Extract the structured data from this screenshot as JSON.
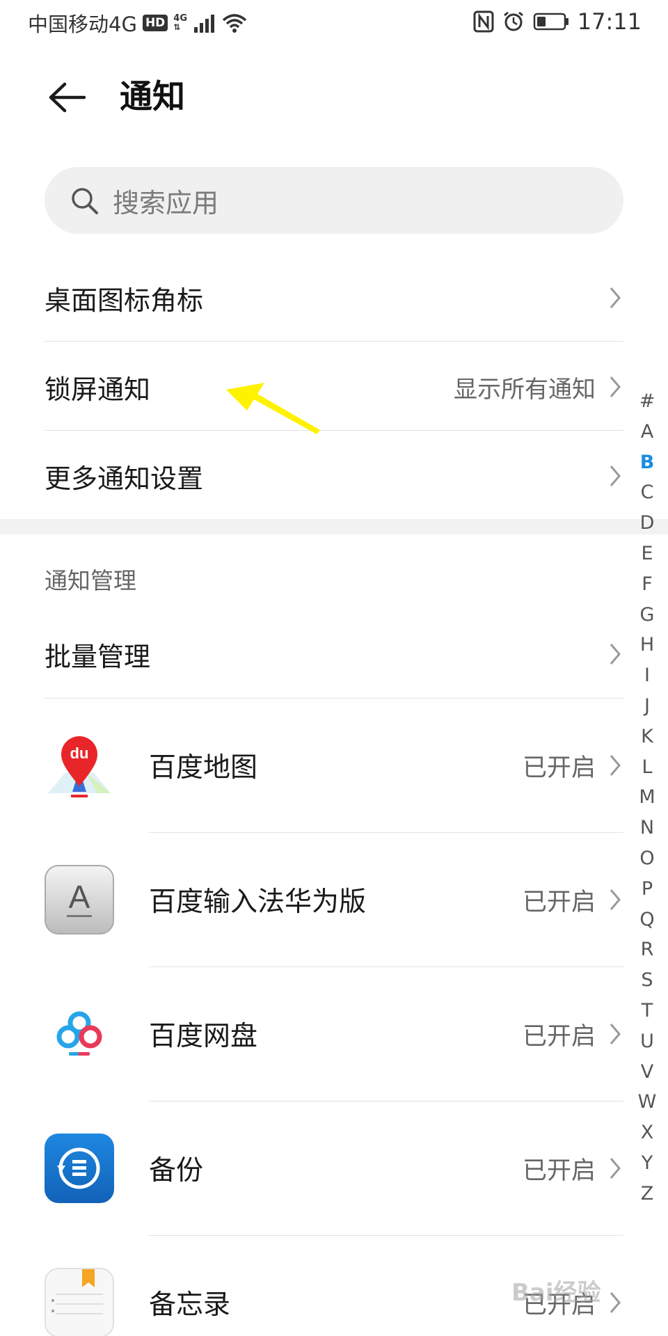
{
  "status_bar": {
    "carrier": "中国移动4G",
    "hd": "HD",
    "network": "4G",
    "time": "17:11"
  },
  "header": {
    "title": "通知"
  },
  "search": {
    "placeholder": "搜索应用"
  },
  "settings_rows": [
    {
      "label": "桌面图标角标",
      "value": ""
    },
    {
      "label": "锁屏通知",
      "value": "显示所有通知"
    },
    {
      "label": "更多通知设置",
      "value": ""
    }
  ],
  "section": {
    "title": "通知管理",
    "batch_label": "批量管理"
  },
  "apps": [
    {
      "name": "百度地图",
      "status": "已开启",
      "icon": "baidu-map-icon"
    },
    {
      "name": "百度输入法华为版",
      "status": "已开启",
      "icon": "baidu-input-icon"
    },
    {
      "name": "百度网盘",
      "status": "已开启",
      "icon": "baidu-netdisk-icon"
    },
    {
      "name": "备份",
      "status": "已开启",
      "icon": "backup-icon"
    },
    {
      "name": "备忘录",
      "status": "已开启",
      "icon": "notes-icon"
    }
  ],
  "alphabet": [
    "#",
    "A",
    "B",
    "C",
    "D",
    "E",
    "F",
    "G",
    "H",
    "I",
    "J",
    "K",
    "L",
    "M",
    "N",
    "O",
    "P",
    "Q",
    "R",
    "S",
    "T",
    "U",
    "V",
    "W",
    "X",
    "Y",
    "Z"
  ],
  "alphabet_active": "B",
  "colors": {
    "accent": "#1a8ee0",
    "arrow": "#fff200"
  },
  "watermark": "Bai经验"
}
